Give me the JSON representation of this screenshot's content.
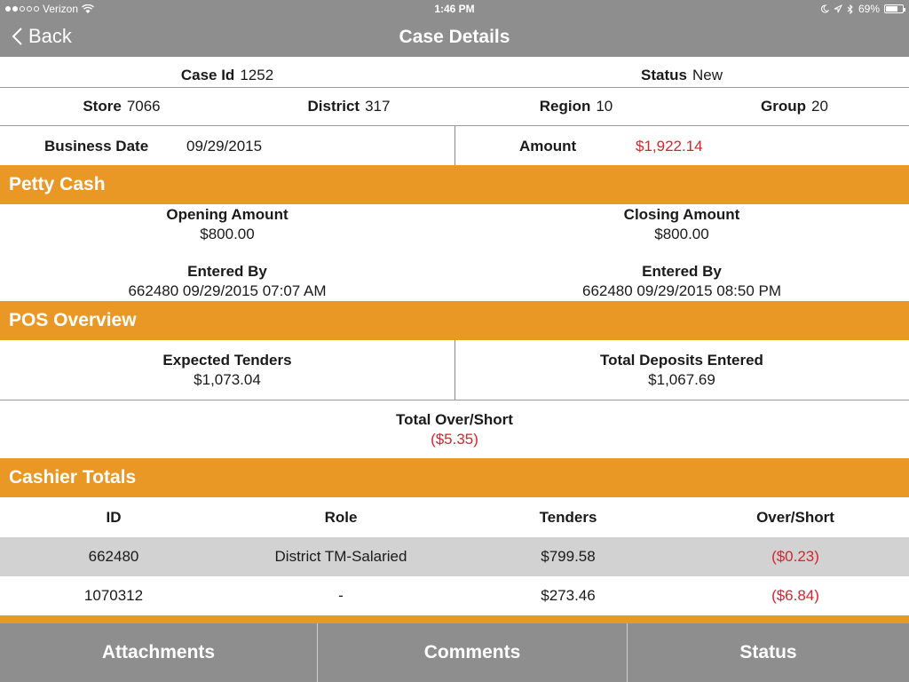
{
  "status_bar": {
    "carrier": "Verizon",
    "time": "1:46 PM",
    "battery": "69%",
    "signal_bars_filled": 2,
    "signal_bars_total": 5,
    "battery_level": 0.69
  },
  "nav": {
    "back_label": "Back",
    "title": "Case Details"
  },
  "case": {
    "case_id_label": "Case Id",
    "case_id": "1252",
    "status_label": "Status",
    "status": "New",
    "store_label": "Store",
    "store": "7066",
    "district_label": "District",
    "district": "317",
    "region_label": "Region",
    "region": "10",
    "group_label": "Group",
    "group": "20",
    "business_date_label": "Business Date",
    "business_date": "09/29/2015",
    "amount_label": "Amount",
    "amount": "$1,922.14"
  },
  "petty_cash": {
    "title": "Petty Cash",
    "opening_label": "Opening Amount",
    "opening_value": "$800.00",
    "closing_label": "Closing Amount",
    "closing_value": "$800.00",
    "opening_entered_by_label": "Entered By",
    "opening_entered_by": "662480 09/29/2015 07:07 AM",
    "closing_entered_by_label": "Entered By",
    "closing_entered_by": "662480 09/29/2015 08:50 PM"
  },
  "pos": {
    "title": "POS Overview",
    "expected_label": "Expected Tenders",
    "expected_value": "$1,073.04",
    "deposits_label": "Total Deposits Entered",
    "deposits_value": "$1,067.69",
    "over_short_label": "Total Over/Short",
    "over_short_value": "($5.35)"
  },
  "cashier": {
    "title": "Cashier Totals",
    "headers": [
      "ID",
      "Role",
      "Tenders",
      "Over/Short"
    ],
    "rows": [
      [
        "662480",
        "District TM-Salaried",
        "$799.58",
        "($0.23)"
      ],
      [
        "1070312",
        "-",
        "$273.46",
        "($6.84)"
      ]
    ]
  },
  "tabs": {
    "attachments": "Attachments",
    "comments": "Comments",
    "status": "Status"
  },
  "colors": {
    "accent": "#e99826",
    "bar": "#8e8e8e",
    "negative": "#d9232d"
  }
}
